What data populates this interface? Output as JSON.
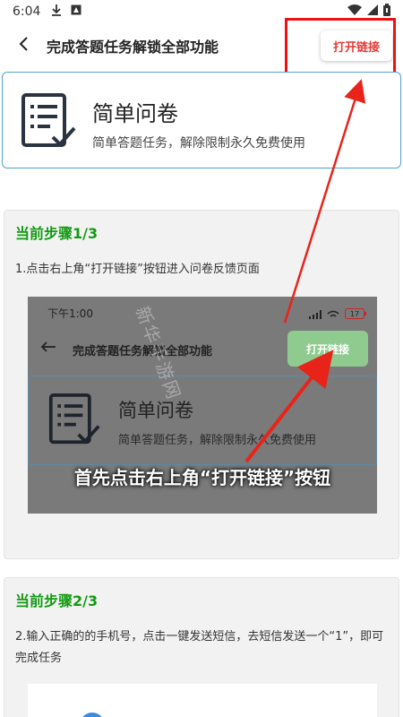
{
  "status_bar": {
    "time": "6:04",
    "left_icons": [
      "download-icon",
      "app-icon"
    ],
    "right_icons": [
      "wifi-icon",
      "signal-icon",
      "battery-icon"
    ]
  },
  "app_bar": {
    "title": "完成答题任务解锁全部功能",
    "open_link_label": "打开链接"
  },
  "survey": {
    "title": "简单问卷",
    "subtitle": "简单答题任务，解除限制永久免费使用"
  },
  "steps": [
    {
      "heading": "当前步骤1/3",
      "description": "1.点击右上角“打开链接”按钮进入问卷反馈页面",
      "screenshot": {
        "time": "下午1:00",
        "battery": "17",
        "title": "完成答题任务解锁全部功能",
        "button_label": "打开链接",
        "card_title": "简单问卷",
        "card_subtitle": "简单答题任务，解除限制永久免费使用",
        "caption": "首先点击右上角“打开链接”按钮",
        "watermark": "新华手游网"
      }
    },
    {
      "heading": "当前步骤2/3",
      "description": "2.输入正确的的手机号，点击一键发送短信，去短信发送一个“1”，即可完成任务"
    }
  ],
  "colors": {
    "accent_red": "#e53935",
    "step_green": "#129a12",
    "card_border_blue": "#4fa3d9",
    "screenshot_button_green": "#8fca8f"
  }
}
